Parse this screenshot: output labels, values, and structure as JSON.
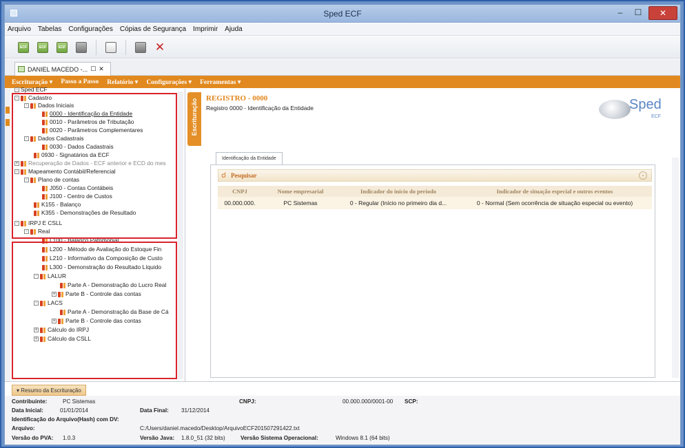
{
  "window": {
    "title": "Sped ECF"
  },
  "menu": [
    "Arquivo",
    "Tabelas",
    "Configurações",
    "Cópias de Segurança",
    "Imprimir",
    "Ajuda"
  ],
  "toolbar": {
    "btn1": "ECF",
    "btn2": "ECF",
    "btn3": "ECF"
  },
  "doc_tab": {
    "label": "DANIEL MACEDO -...",
    "pin": "☐",
    "close": "✕"
  },
  "orange_menu": [
    "Escrituração ▾",
    "Passo a Passo",
    "Relatório ▾",
    "Configurações ▾",
    "Ferramentas ▾"
  ],
  "tree": {
    "root": "Sped ECF",
    "n1": "Cadastro",
    "n2": "Dados Iniciais",
    "n3": "0000 - Identificação da Entidade",
    "n4": "0010 - Parâmetros de Tributação",
    "n5": "0020 - Parâmetros Complementares",
    "n6": "Dados Cadastrais",
    "n7": "0030 - Dados Cadastrais",
    "n8": "0930 - Signatários da ECF",
    "n9": "Recuperação de Dados - ECF anterior e ECD do mes",
    "n10": "Mapeamento Contábil/Referencial",
    "n11": "Plano de contas",
    "n12": "J050 - Contas Contábeis",
    "n13": "J100 - Centro de Custos",
    "n14": "K155 - Balanço",
    "n15": "K355 - Demonstrações de Resultado",
    "n16": "IRPJ E CSLL",
    "n17": "Real",
    "n18": "L100 - Balanço Patrimonial",
    "n19": "L200 - Método de Avaliação do Estoque Fin",
    "n20": "L210 - Informativo da Composição de Custo",
    "n21": "L300 - Demonstração do Resultado Líquido",
    "n22": "LALUR",
    "n23": "Parte A - Demonstração do Lucro Real",
    "n24": "Parte B - Controle das contas",
    "n25": "LACS",
    "n26": "Parte A - Demonstração da Base de Cá",
    "n27": "Parte B - Controle das contas",
    "n28": "Cálculo do IRPJ",
    "n29": "Cálculo da CSLL"
  },
  "vertical_tab": "Escrituração",
  "register": {
    "title": "REGISTRO - 0000",
    "subtitle": "Registro 0000 - Identificação da Entidade"
  },
  "logo": {
    "name": "Sped",
    "sub": "ECF"
  },
  "inner_tab": "Identificação da Entidade",
  "search": {
    "label": "Pesquisar",
    "collapse": "⌄"
  },
  "grid": {
    "headers": [
      "CNPJ",
      "Nome empresarial",
      "Indicador do início do período",
      "Indicador de situação especial e outros eventos"
    ],
    "row": [
      "00.000.000.",
      "PC Sistemas",
      "0 - Regular (Início no primeiro dia d...",
      "0 - Normal (Sem ocorrência de situação especial ou evento)"
    ]
  },
  "summary": {
    "header": "▾ Resumo da Escrituração",
    "contribuinte_label": "Contribuinte:",
    "contribuinte_value": "PC Sistemas",
    "cnpj_label": "CNPJ:",
    "cnpj_value": "00.000.000/0001-00",
    "scp_label": "SCP:",
    "data_inicial_label": "Data Inicial:",
    "data_inicial_value": "01/01/2014",
    "data_final_label": "Data Final:",
    "data_final_value": "31/12/2014",
    "hash_label": "Identificação do Arquivo(Hash) com DV:",
    "arquivo_label": "Arquivo:",
    "arquivo_value": "C:/Users/daniel.macedo/Desktop/ArquivoECF201507291422.txt",
    "pva_label": "Versão do PVA:",
    "pva_value": "1.0.3",
    "java_label": "Versão Java:",
    "java_value": "1.8.0_51 (32 bits)",
    "so_label": "Versão Sistema Operacional:",
    "so_value": "Windows 8.1 (64 bits)"
  }
}
